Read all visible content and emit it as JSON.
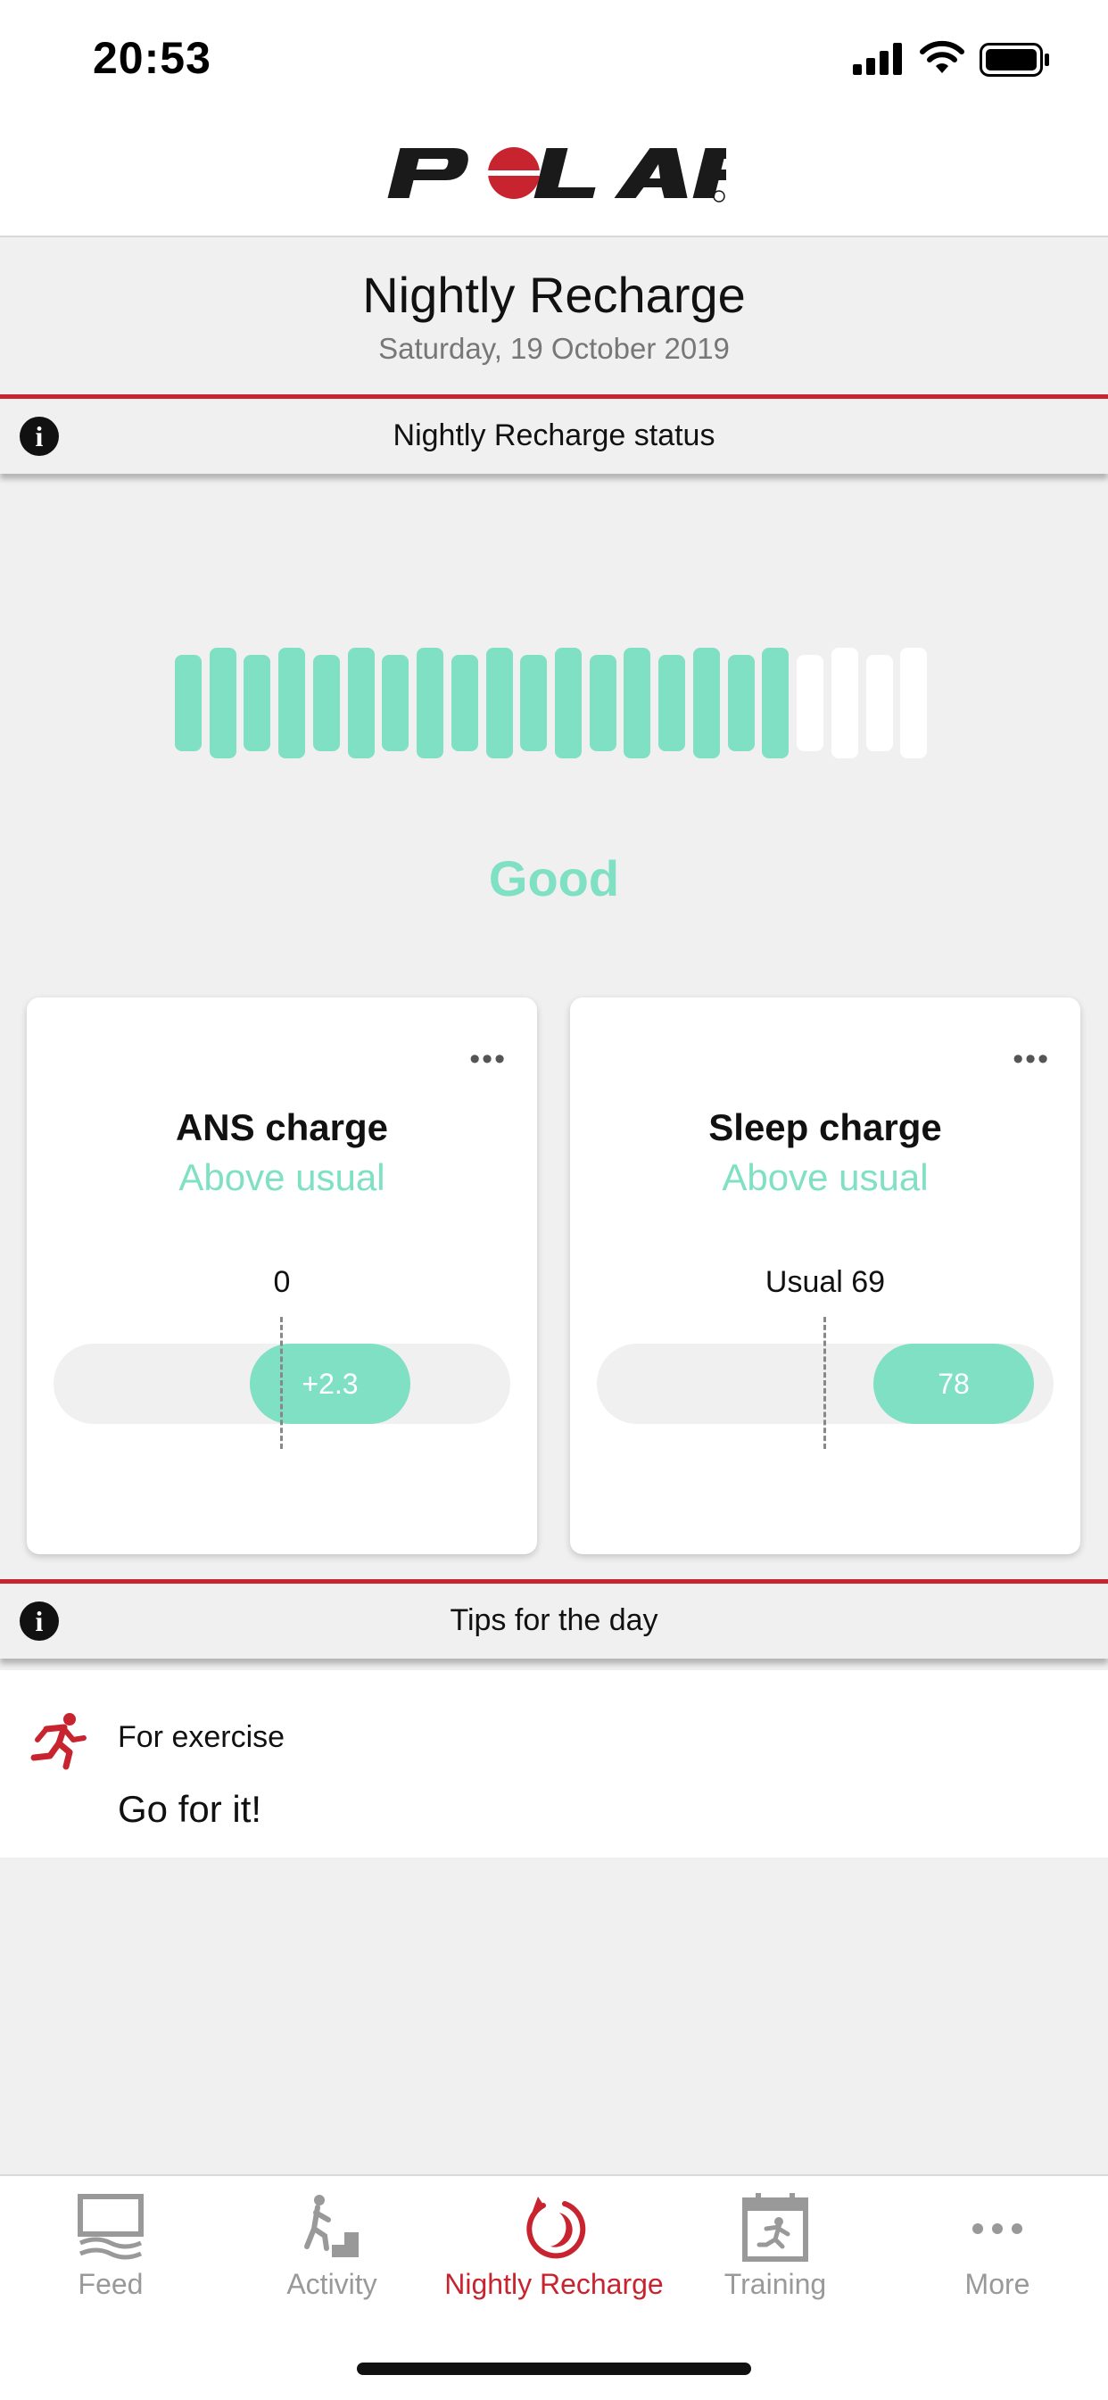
{
  "status_bar": {
    "time": "20:53"
  },
  "header": {
    "logo": "POLAR"
  },
  "page": {
    "title": "Nightly Recharge",
    "date": "Saturday, 19 October 2019"
  },
  "status_section": {
    "label": "Nightly Recharge status",
    "status": "Good",
    "level_filled": 18,
    "level_total": 22
  },
  "ans_card": {
    "title": "ANS charge",
    "subtitle": "Above usual",
    "reference_label": "0",
    "value": "+2.3"
  },
  "sleep_card": {
    "title": "Sleep charge",
    "subtitle": "Above usual",
    "reference_label": "Usual 69",
    "value": "78"
  },
  "tips_section": {
    "label": "Tips for the day",
    "category": "For exercise",
    "tip": "Go for it!"
  },
  "tabs": [
    {
      "label": "Feed",
      "icon": "feed-icon"
    },
    {
      "label": "Activity",
      "icon": "activity-icon"
    },
    {
      "label": "Nightly Recharge",
      "icon": "nightly-recharge-icon",
      "active": true
    },
    {
      "label": "Training",
      "icon": "training-icon"
    },
    {
      "label": "More",
      "icon": "more-icon"
    }
  ],
  "colors": {
    "accent_red": "#c8242f",
    "good_green": "#7fe0c3"
  }
}
